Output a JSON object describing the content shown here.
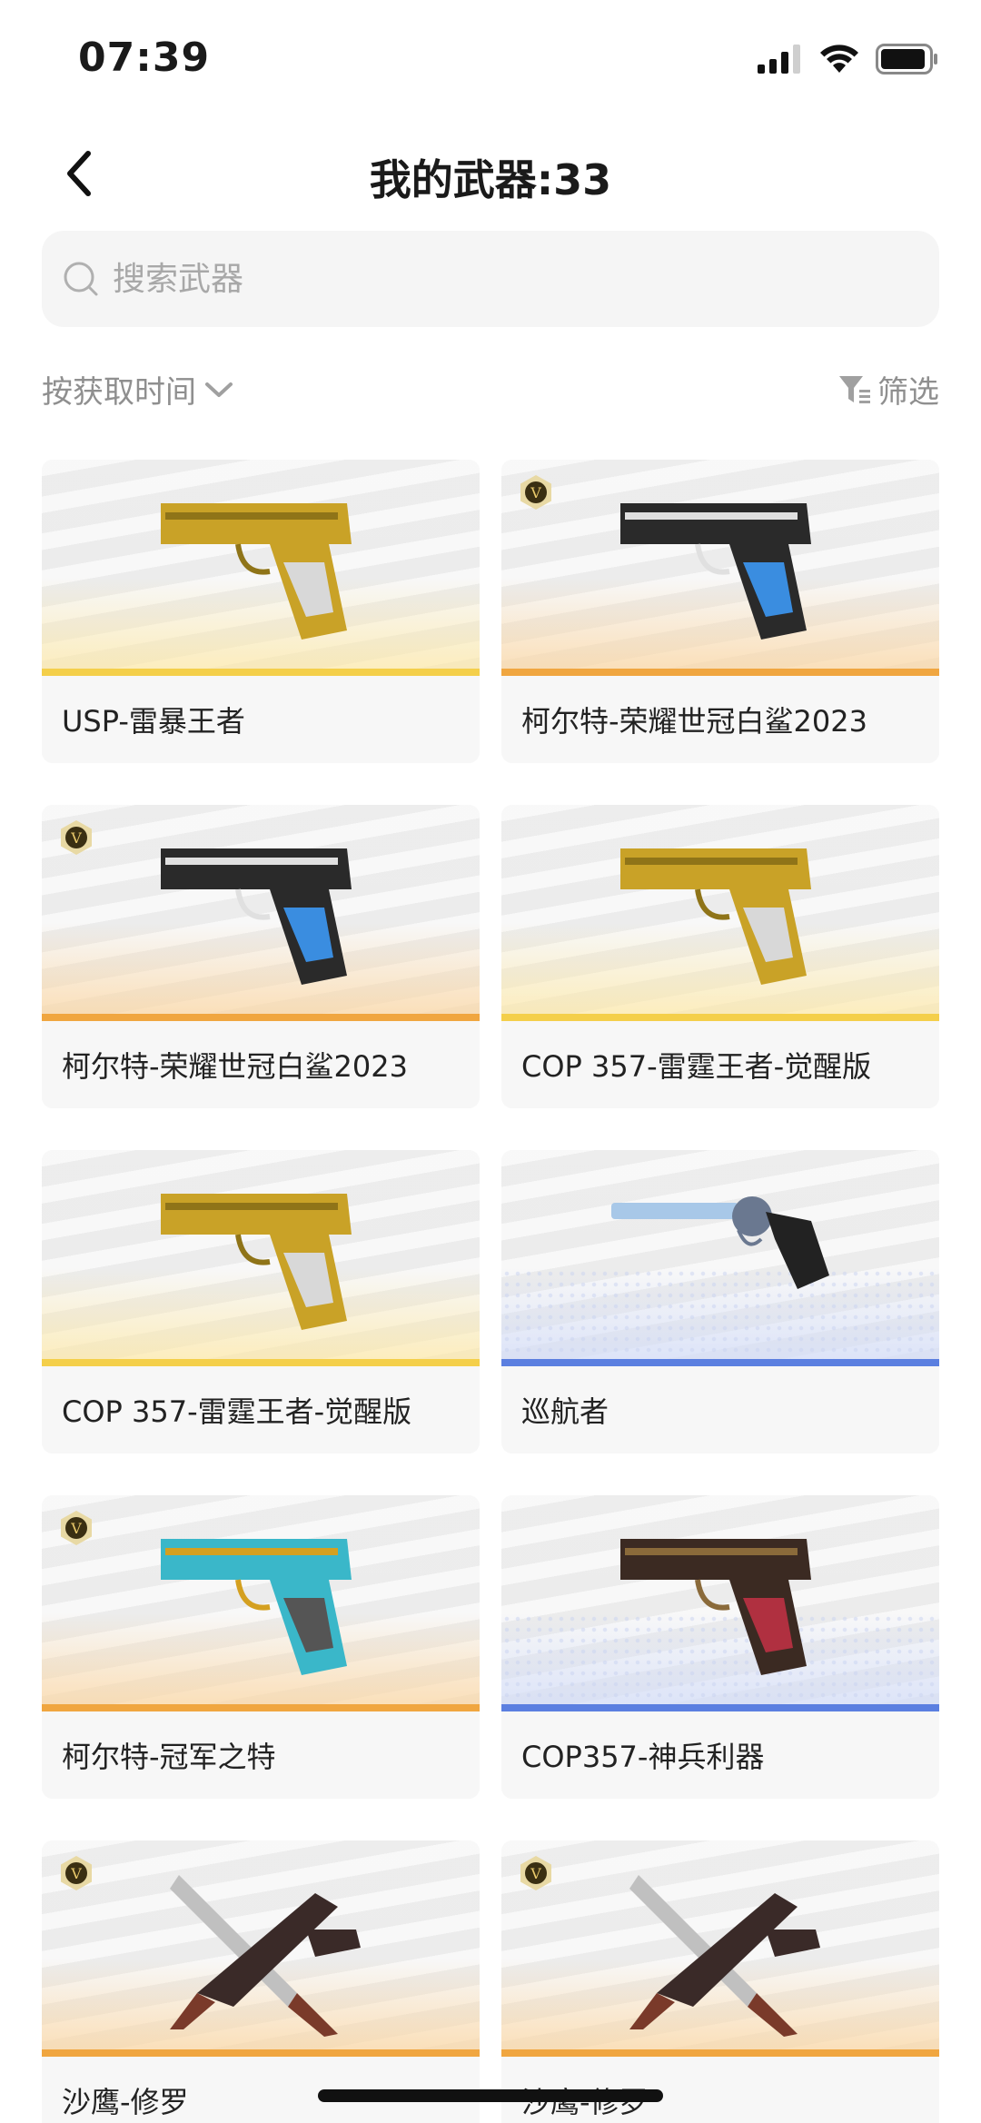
{
  "status_bar": {
    "time": "07:39"
  },
  "nav": {
    "title": "我的武器:33"
  },
  "search": {
    "placeholder": "搜索武器"
  },
  "toolbar": {
    "sort_label": "按获取时间",
    "filter_label": "筛选"
  },
  "colors": {
    "gold": "#f4cf4a",
    "orange": "#f0a640",
    "blue": "#5b7fe0"
  },
  "weapons": [
    {
      "name": "USP-雷暴王者",
      "rarity": "gold",
      "badge": false,
      "icon": "pistol-gold-icon"
    },
    {
      "name": "柯尔特-荣耀世冠白鲨2023",
      "rarity": "orange",
      "badge": true,
      "icon": "pistol-blackwhite-icon"
    },
    {
      "name": "柯尔特-荣耀世冠白鲨2023",
      "rarity": "orange",
      "badge": true,
      "icon": "pistol-blackwhite-icon"
    },
    {
      "name": "COP 357-雷霆王者-觉醒版",
      "rarity": "gold",
      "badge": false,
      "icon": "pistol-gold-icon"
    },
    {
      "name": "COP 357-雷霆王者-觉醒版",
      "rarity": "gold",
      "badge": false,
      "icon": "pistol-gold-icon"
    },
    {
      "name": "巡航者",
      "rarity": "blue",
      "badge": false,
      "icon": "revolver-icon"
    },
    {
      "name": "柯尔特-冠军之特",
      "rarity": "orange",
      "badge": true,
      "icon": "pistol-teal-icon"
    },
    {
      "name": "COP357-神兵利器",
      "rarity": "blue",
      "badge": false,
      "icon": "pistol-dark-icon"
    },
    {
      "name": "沙鹰-修罗",
      "rarity": "orange",
      "badge": true,
      "icon": "deagle-knife-icon"
    },
    {
      "name": "沙鹰-修罗",
      "rarity": "orange",
      "badge": true,
      "icon": "deagle-knife-icon"
    }
  ]
}
